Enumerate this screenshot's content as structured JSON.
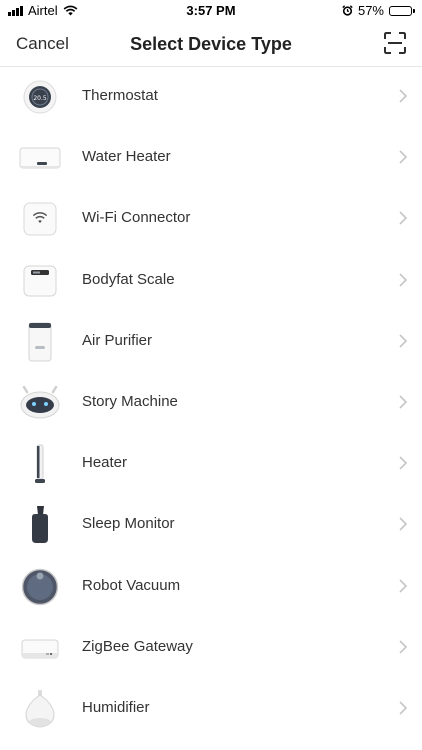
{
  "status_bar": {
    "carrier": "Airtel",
    "time": "3:57 PM",
    "battery": "57%",
    "battery_level": 0.57
  },
  "nav": {
    "cancel_label": "Cancel",
    "title": "Select Device Type"
  },
  "devices": [
    {
      "label": "Thermostat",
      "icon": "thermostat-icon",
      "display_value": "20.5"
    },
    {
      "label": "Water Heater",
      "icon": "water-heater-icon"
    },
    {
      "label": "Wi-Fi Connector",
      "icon": "wifi-connector-icon"
    },
    {
      "label": "Bodyfat Scale",
      "icon": "bodyfat-scale-icon"
    },
    {
      "label": "Air Purifier",
      "icon": "air-purifier-icon"
    },
    {
      "label": "Story Machine",
      "icon": "story-machine-icon"
    },
    {
      "label": "Heater",
      "icon": "heater-icon"
    },
    {
      "label": "Sleep Monitor",
      "icon": "sleep-monitor-icon"
    },
    {
      "label": "Robot Vacuum",
      "icon": "robot-vacuum-icon"
    },
    {
      "label": "ZigBee Gateway",
      "icon": "zigbee-gateway-icon"
    },
    {
      "label": "Humidifier",
      "icon": "humidifier-icon"
    }
  ]
}
